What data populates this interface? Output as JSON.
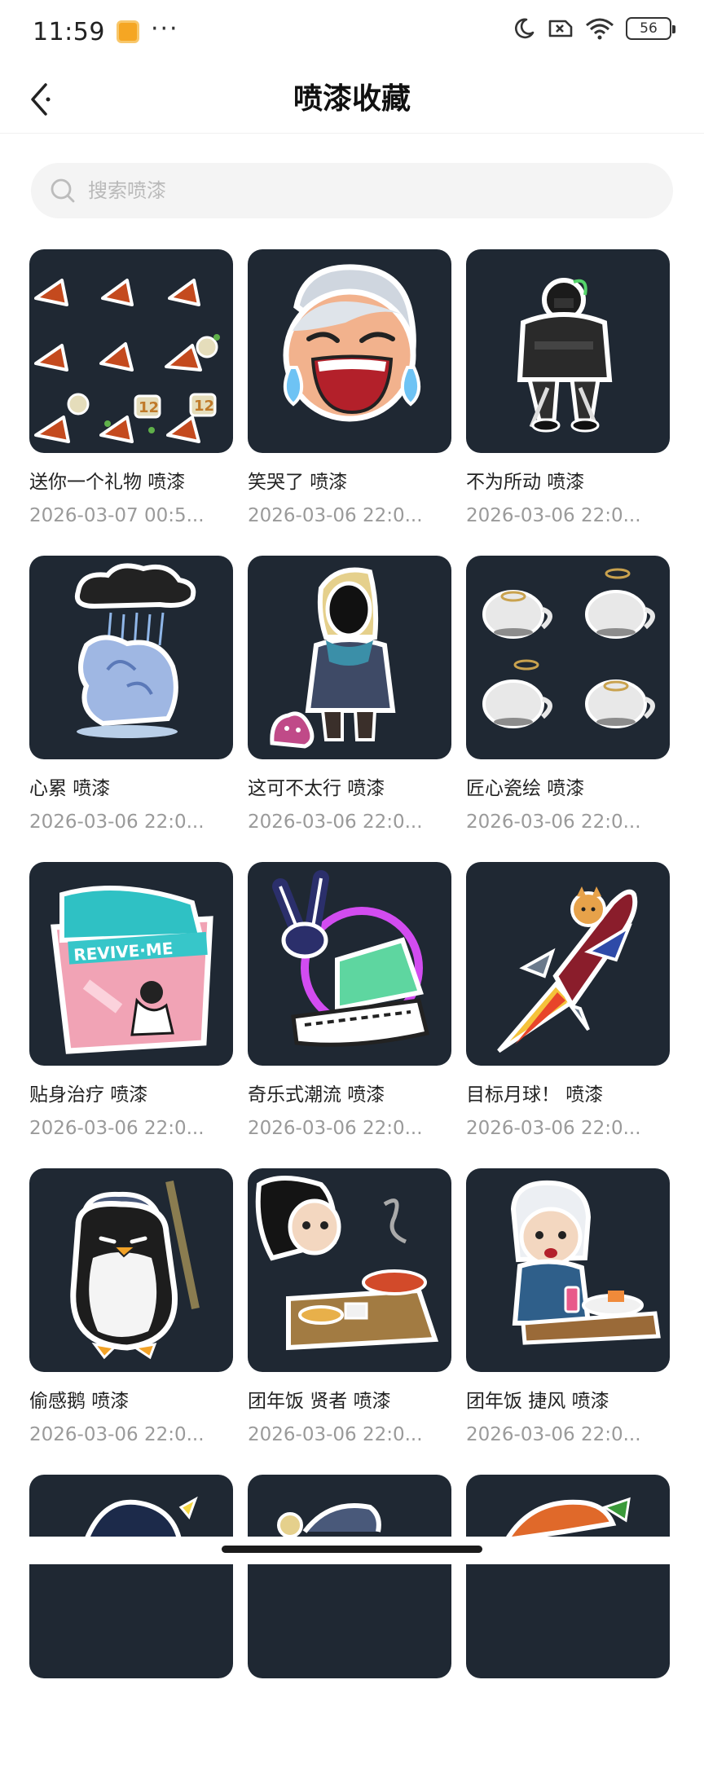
{
  "status": {
    "time": "11:59",
    "battery": "56"
  },
  "header": {
    "title": "喷漆收藏"
  },
  "search": {
    "placeholder": "搜索喷漆",
    "value": ""
  },
  "items": [
    {
      "title": "送你一个礼物 喷漆",
      "date": "2026-03-07 00:5..."
    },
    {
      "title": "笑哭了 喷漆",
      "date": "2026-03-06 22:0..."
    },
    {
      "title": "不为所动 喷漆",
      "date": "2026-03-06 22:0..."
    },
    {
      "title": "心累 喷漆",
      "date": "2026-03-06 22:0..."
    },
    {
      "title": "这可不太行 喷漆",
      "date": "2026-03-06 22:0..."
    },
    {
      "title": "匠心瓷绘 喷漆",
      "date": "2026-03-06 22:0..."
    },
    {
      "title": "贴身治疗 喷漆",
      "date": "2026-03-06 22:0..."
    },
    {
      "title": "奇乐式潮流 喷漆",
      "date": "2026-03-06 22:0..."
    },
    {
      "title": "目标月球！ 喷漆",
      "date": "2026-03-06 22:0..."
    },
    {
      "title": "偷感鹅 喷漆",
      "date": "2026-03-06 22:0..."
    },
    {
      "title": "团年饭 贤者 喷漆",
      "date": "2026-03-06 22:0..."
    },
    {
      "title": "团年饭 捷风 喷漆",
      "date": "2026-03-06 22:0..."
    }
  ],
  "sticker_art": {
    "revive_text": "REVIVE·ME",
    "score_text": "12"
  },
  "colors": {
    "tile_bg": "#1f2833",
    "date_text": "#9a9a9a",
    "search_bg": "#f4f4f4"
  }
}
